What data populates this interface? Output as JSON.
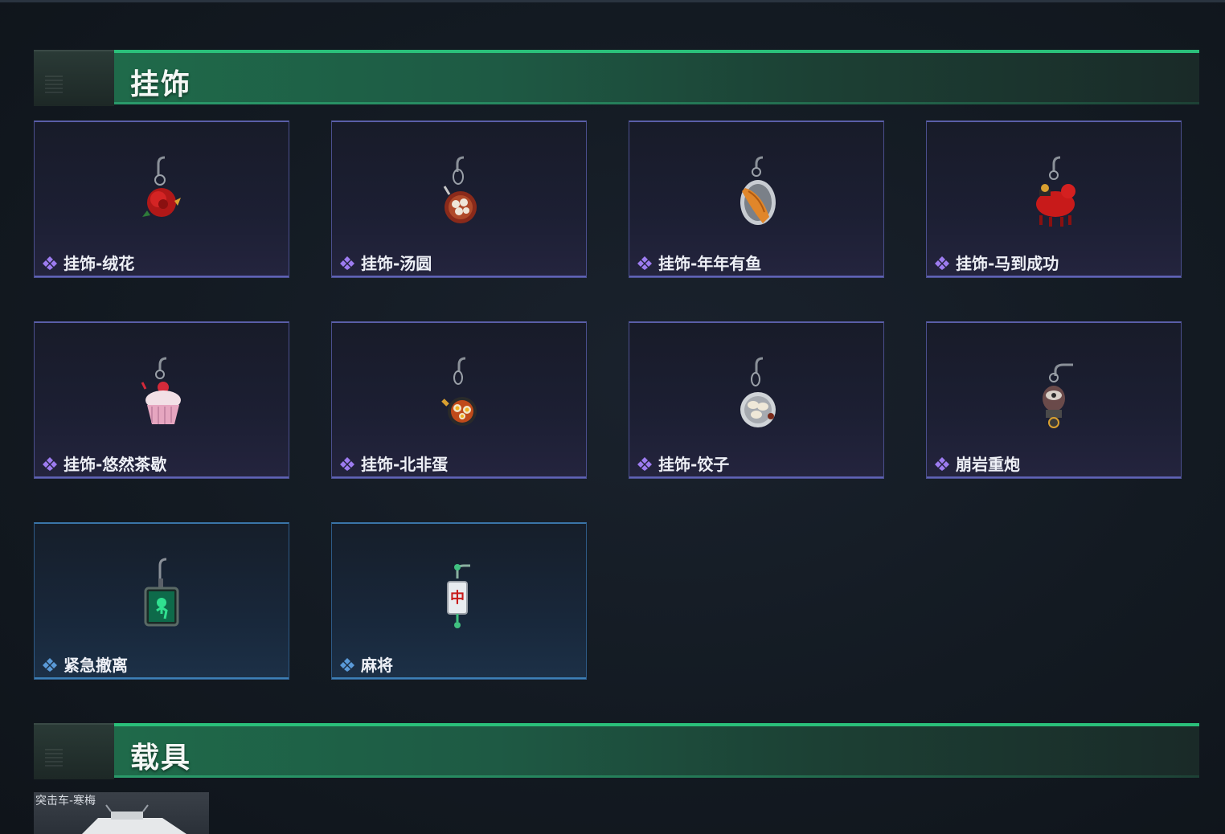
{
  "sections": {
    "charms": {
      "title": "挂饰"
    },
    "vehicles": {
      "title": "载具"
    }
  },
  "charm_items": [
    {
      "label": "挂饰-绒花",
      "icon": "rose-charm-icon",
      "rarity": "purple"
    },
    {
      "label": "挂饰-汤圆",
      "icon": "tangyuan-bowl-charm-icon",
      "rarity": "purple"
    },
    {
      "label": "挂饰-年年有鱼",
      "icon": "fish-plate-charm-icon",
      "rarity": "purple"
    },
    {
      "label": "挂饰-马到成功",
      "icon": "red-horse-charm-icon",
      "rarity": "purple"
    },
    {
      "label": "挂饰-悠然茶歇",
      "icon": "cupcake-charm-icon",
      "rarity": "purple"
    },
    {
      "label": "挂饰-北非蛋",
      "icon": "shakshuka-pan-charm-icon",
      "rarity": "purple"
    },
    {
      "label": "挂饰-饺子",
      "icon": "dumpling-plate-charm-icon",
      "rarity": "purple"
    },
    {
      "label": "崩岩重炮",
      "icon": "robot-charm-icon",
      "rarity": "purple"
    },
    {
      "label": "紧急撤离",
      "icon": "green-evacuation-tag-charm-icon",
      "rarity": "blue"
    },
    {
      "label": "麻将",
      "icon": "mahjong-tile-charm-icon",
      "rarity": "blue"
    }
  ],
  "vehicle_items": [
    {
      "label": "突击车-寒梅",
      "icon": "assault-vehicle-icon"
    }
  ],
  "colors": {
    "purple_border": "#5a5ea8",
    "blue_border": "#3a74a8",
    "header_green": "#2ac07a"
  }
}
